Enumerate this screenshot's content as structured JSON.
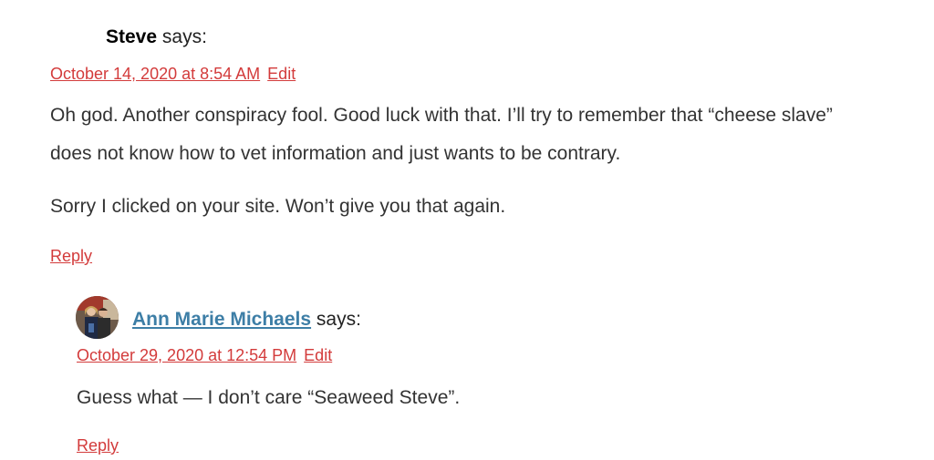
{
  "comments": [
    {
      "author": "Steve",
      "says": "says:",
      "date": "October 14, 2020 at 8:54 AM",
      "edit": "Edit",
      "paragraphs": [
        "Oh god. Another conspiracy fool. Good luck with that. I’ll try to remember that “cheese slave” does not know how to vet information and just wants to be contrary.",
        "Sorry I clicked on your site. Won’t give you that again."
      ],
      "reply": "Reply"
    },
    {
      "author": "Ann Marie Michaels",
      "says": "says:",
      "date": "October 29, 2020 at 12:54 PM",
      "edit": "Edit",
      "paragraphs": [
        "Guess what — I don’t care “Seaweed Steve”."
      ],
      "reply": "Reply"
    }
  ]
}
